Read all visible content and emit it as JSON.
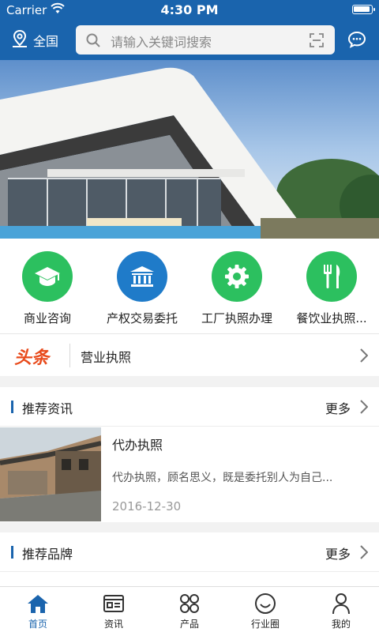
{
  "status_bar": {
    "carrier": "Carrier",
    "time": "4:30 PM"
  },
  "header": {
    "location": "全国",
    "search_placeholder": "请输入关键词搜索"
  },
  "colors": {
    "primary": "#1a64ad",
    "category_green": "#2cc05f",
    "category_blue": "#1f7bc9",
    "headline_tag": "#e84a1b"
  },
  "categories": [
    {
      "label": "商业咨询",
      "icon": "graduation-cap-icon",
      "color": "#2cc05f"
    },
    {
      "label": "产权交易委托",
      "icon": "bank-building-icon",
      "color": "#1f7bc9"
    },
    {
      "label": "工厂执照办理",
      "icon": "gear-icon",
      "color": "#2cc05f"
    },
    {
      "label": "餐饮业执照...",
      "icon": "fork-knife-icon",
      "color": "#2cc05f"
    }
  ],
  "headline": {
    "tag": "头条",
    "text": "营业执照"
  },
  "recommended_news": {
    "title": "推荐资讯",
    "more": "更多",
    "items": [
      {
        "title": "代办执照",
        "desc": "代办执照，顾名思义，既是委托别人为自己...",
        "date": "2016-12-30"
      }
    ]
  },
  "recommended_brands": {
    "title": "推荐品牌",
    "more": "更多"
  },
  "tabs": [
    {
      "label": "首页",
      "icon": "home-icon",
      "active": true
    },
    {
      "label": "资讯",
      "icon": "news-icon",
      "active": false
    },
    {
      "label": "产品",
      "icon": "grid-icon",
      "active": false
    },
    {
      "label": "行业圈",
      "icon": "smile-circle-icon",
      "active": false
    },
    {
      "label": "我的",
      "icon": "user-icon",
      "active": false
    }
  ]
}
